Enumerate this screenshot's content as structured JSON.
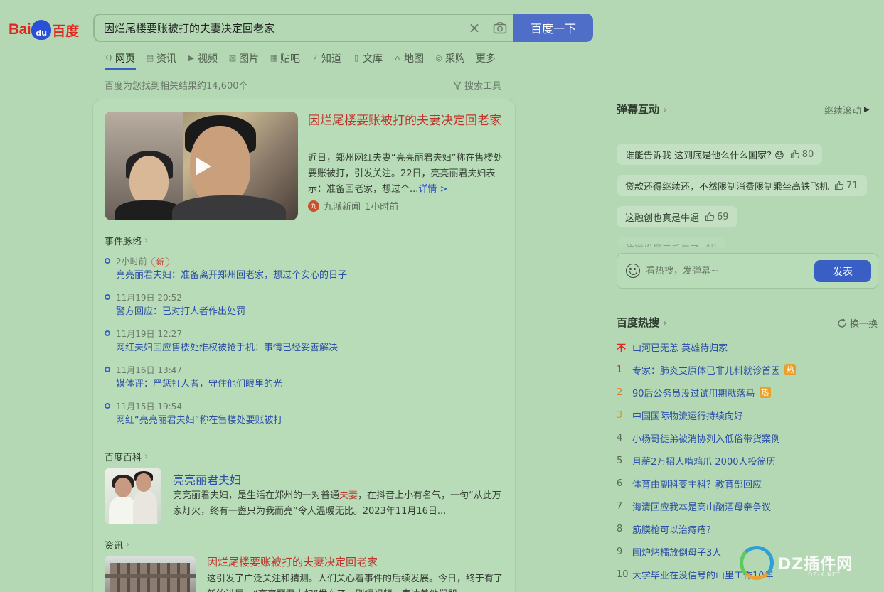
{
  "logo": {
    "bai": "Bai",
    "du": "du",
    "baidu": "百度"
  },
  "search": {
    "query": "因烂尾楼要账被打的夫妻决定回老家",
    "clear": "×",
    "button": "百度一下"
  },
  "tabs": [
    {
      "icon": "Q",
      "label": "网页"
    },
    {
      "icon": "▤",
      "label": "资讯"
    },
    {
      "icon": "▶",
      "label": "视频"
    },
    {
      "icon": "▧",
      "label": "图片"
    },
    {
      "icon": "▦",
      "label": "贴吧"
    },
    {
      "icon": "?",
      "label": "知道"
    },
    {
      "icon": "▯",
      "label": "文库"
    },
    {
      "icon": "⌂",
      "label": "地图"
    },
    {
      "icon": "◎",
      "label": "采购"
    },
    {
      "icon": "",
      "label": "更多"
    }
  ],
  "result_count": "百度为您找到相关结果约14,600个",
  "search_tools": "搜索工具",
  "top_result": {
    "title": "因烂尾楼要账被打的夫妻决定回老家",
    "desc": "近日，郑州网红夫妻“亮亮丽君夫妇”称在售楼处要账被打，引发关注。22日，亮亮丽君夫妇表示：准备回老家，想过个...",
    "more": "详情 >",
    "source": "九派新闻",
    "source_icon": "九",
    "time": "1小时前"
  },
  "timeline": {
    "heading": "事件脉络",
    "new_badge": "新",
    "items": [
      {
        "time": "2小时前",
        "text": "亮亮丽君夫妇：准备离开郑州回老家，想过个安心的日子"
      },
      {
        "time": "11月19日 20:52",
        "text": "警方回应：已对打人者作出处罚"
      },
      {
        "time": "11月19日 12:27",
        "text": "网红夫妇回应售楼处维权被抢手机：事情已经妥善解决"
      },
      {
        "time": "11月16日 13:47",
        "text": "媒体评：严惩打人者，守住他们眼里的光"
      },
      {
        "time": "11月15日 19:54",
        "text": "网红“亮亮丽君夫妇”称在售楼处要账被打"
      }
    ]
  },
  "baike": {
    "heading": "百度百科",
    "title": "亮亮丽君夫妇",
    "desc_a": "亮亮丽君夫妇，是生活在郑州的一对普通",
    "desc_hl": "夫妻",
    "desc_b": "，在抖音上小有名气，一句“从此万家灯火，终有一盏只为我而亮”令人温暖无比。2023年11月16日..."
  },
  "news": {
    "heading": "资讯",
    "title": "因烂尾楼要账被打的夫妻决定回老家",
    "desc": "这引发了广泛关注和猜测。人们关心着事件的后续发展。今日，终于有了新的进展，“亮亮丽君夫妇”发布了一则短视频，表达着他们即..."
  },
  "danmu": {
    "title": "弹幕互动",
    "continue": "继续滚动",
    "items": [
      {
        "text": "谁能告诉我 这到底是他么什么国家? 😓",
        "likes": "80"
      },
      {
        "text": "贷款还得继续还，不然限制消费限制乘坐高铁飞机",
        "likes": "71"
      },
      {
        "text": "这融创也真是牛逼",
        "likes": "69"
      },
      {
        "text": "信道发展五千年了",
        "likes": "48"
      }
    ],
    "placeholder": "看热搜，发弹幕~",
    "send": "发表"
  },
  "hot": {
    "title": "百度热搜",
    "refresh": "换一换",
    "badge": "热",
    "items": [
      {
        "rank": "不",
        "text": "山河已无恙 英雄待归家",
        "badge": false
      },
      {
        "rank": "1",
        "text": "专家：肺炎支原体已非儿科就诊首因",
        "badge": true
      },
      {
        "rank": "2",
        "text": "90后公务员没过试用期就落马",
        "badge": true
      },
      {
        "rank": "3",
        "text": "中国国际物流运行持续向好",
        "badge": false
      },
      {
        "rank": "4",
        "text": "小杨哥徒弟被消协列入低俗带货案例",
        "badge": false
      },
      {
        "rank": "5",
        "text": "月薪2万招人啃鸡爪 2000人投简历",
        "badge": false
      },
      {
        "rank": "6",
        "text": "体育由副科变主科？教育部回应",
        "badge": false
      },
      {
        "rank": "7",
        "text": "海清回应我本是高山酗酒母亲争议",
        "badge": false
      },
      {
        "rank": "8",
        "text": "筋膜枪可以治痔疮?",
        "badge": false
      },
      {
        "rank": "9",
        "text": "围炉烤橘放倒母子3人",
        "badge": false
      },
      {
        "rank": "10",
        "text": "大学毕业在没信号的山里工作10年",
        "badge": false
      }
    ]
  },
  "watermark": {
    "text": "DZ插件网",
    "sub": "DZ-X.NET"
  }
}
